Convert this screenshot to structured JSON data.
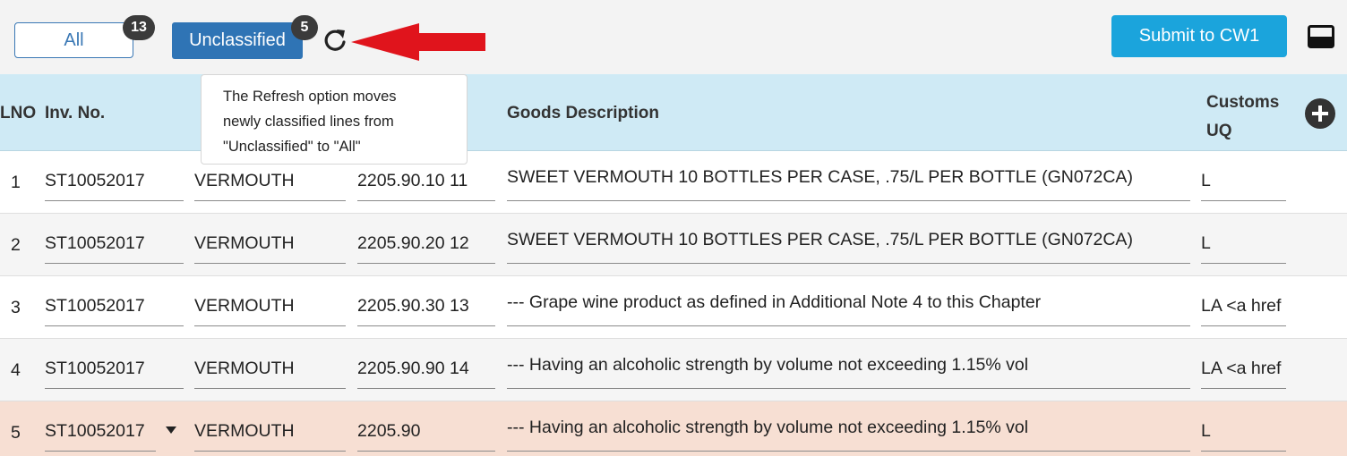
{
  "tabs": {
    "all": {
      "label": "All",
      "count": "13"
    },
    "unclassified": {
      "label": "Unclassified",
      "count": "5"
    }
  },
  "toolbar": {
    "submit_label": "Submit to CW1",
    "refresh_icon": "refresh-icon",
    "panel_icon": "panel-toggle-icon"
  },
  "tooltip": {
    "lines": [
      "The Refresh option moves",
      "newly classified lines from",
      "\"Unclassified\" to \"All\""
    ]
  },
  "table": {
    "headers": {
      "lno": "LNO",
      "inv": "Inv. No.",
      "goods": "Goods Description",
      "customs_uq_line1": "Customs",
      "customs_uq_line2": "UQ"
    },
    "rows": [
      {
        "lno": "1",
        "inv": "ST10052017",
        "desc": "VERMOUTH",
        "tariff": "2205.90.10 11",
        "goods": "SWEET VERMOUTH 10 BOTTLES PER CASE, .75/L PER BOTTLE (GN072CA)",
        "uq": "L"
      },
      {
        "lno": "2",
        "inv": "ST10052017",
        "desc": "VERMOUTH",
        "tariff": "2205.90.20 12",
        "goods": "SWEET VERMOUTH 10 BOTTLES PER CASE, .75/L PER BOTTLE (GN072CA)",
        "uq": "L"
      },
      {
        "lno": "3",
        "inv": "ST10052017",
        "desc": "VERMOUTH",
        "tariff": "2205.90.30 13",
        "goods": "--- Grape wine product as defined in Additional Note 4 to this Chapter",
        "uq": "LA <a href"
      },
      {
        "lno": "4",
        "inv": "ST10052017",
        "desc": "VERMOUTH",
        "tariff": "2205.90.90 14",
        "goods": "--- Having an alcoholic strength by volume not exceeding 1.15% vol",
        "uq": "LA <a href"
      },
      {
        "lno": "5",
        "inv": "ST10052017",
        "desc": "VERMOUTH",
        "tariff": "2205.90",
        "goods": "--- Having an alcoholic strength by volume not exceeding 1.15% vol",
        "uq": "L"
      }
    ]
  },
  "colors": {
    "header_bg": "#cfeaf5",
    "active_tab": "#2f74b5",
    "submit": "#1ba4dc",
    "highlight_row": "#f7dfd3",
    "arrow": "#e0141c"
  }
}
